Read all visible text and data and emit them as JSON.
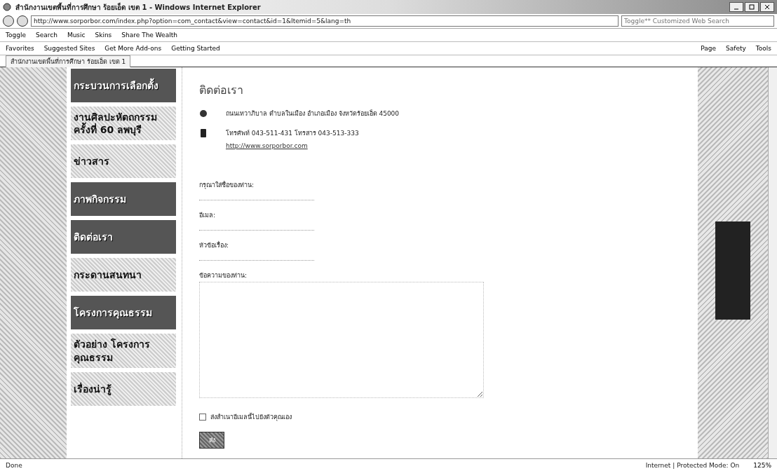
{
  "window": {
    "title": "สำนักงานเขตพื้นที่การศึกษา ร้อยเอ็ด เขต 1 - Windows Internet Explorer"
  },
  "address_bar": {
    "url": "http://www.sorporbor.com/index.php?option=com_contact&view=contact&id=1&Itemid=5&lang=th"
  },
  "search": {
    "placeholder": "Toggle** Customized Web Search"
  },
  "toolbar": {
    "items": [
      "Toggle",
      "Search",
      "Music",
      "Skins",
      "Share The Wealth"
    ]
  },
  "favorites_bar": {
    "items": [
      "Favorites",
      "Suggested Sites",
      "Get More Add-ons",
      "Getting Started"
    ],
    "commands": [
      "Page",
      "Safety",
      "Tools"
    ]
  },
  "tab": {
    "title": "สำนักงานเขตพื้นที่การศึกษา ร้อยเอ็ด เขต 1"
  },
  "sidebar": {
    "items": [
      {
        "label": "กระบวนการเลือกตั้ง",
        "kind": "dark"
      },
      {
        "label": "งานศิลปะหัตถกรรม ครั้งที่ 60 ลพบุรี",
        "kind": "light"
      },
      {
        "label": "ข่าวสาร",
        "kind": "light"
      },
      {
        "label": "ภาพกิจกรรม",
        "kind": "dark"
      },
      {
        "label": "ติดต่อเรา",
        "kind": "dark"
      },
      {
        "label": "กระดานสนทนา",
        "kind": "light"
      },
      {
        "label": "โครงการคุณธรรม",
        "kind": "dark"
      },
      {
        "label": "ตัวอย่าง โครงการคุณธรรม",
        "kind": "light"
      },
      {
        "label": "เรื่องน่ารู้",
        "kind": "light"
      }
    ]
  },
  "contact": {
    "title": "ติดต่อเรา",
    "address": "ถนนเทวาภิบาล ตำบลในเมือง อำเภอเมือง จังหวัดร้อยเอ็ด 45000",
    "phone": "โทรศัพท์ 043-511-431 โทรสาร 043-513-333",
    "website": "http://www.sorporbor.com"
  },
  "form": {
    "fields": [
      {
        "label": "กรุณาใส่ชื่อของท่าน:",
        "kind": "line"
      },
      {
        "label": "อีเมล:",
        "kind": "line"
      },
      {
        "label": "หัวข้อเรื่อง:",
        "kind": "line"
      },
      {
        "label": "ข้อความของท่าน:",
        "kind": "area"
      }
    ],
    "copy_checkbox": {
      "label": "ส่งสำเนาอีเมลนี้ไปยังตัวคุณเอง",
      "checked": false
    },
    "submit": "ส่ง"
  },
  "status_bar": {
    "left": "Done",
    "zone": "Internet | Protected Mode: On",
    "zoom": "125%"
  }
}
